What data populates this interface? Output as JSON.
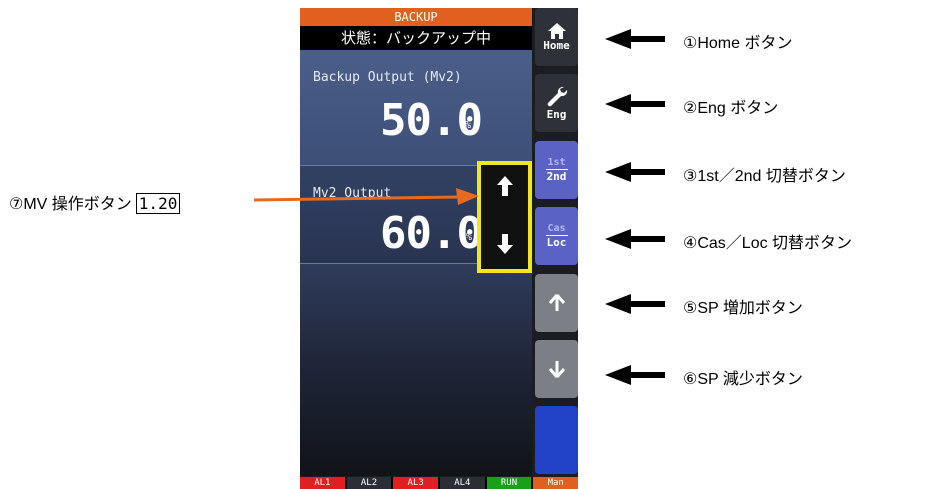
{
  "device": {
    "mode": "BACKUP",
    "state": "状態：バックアップ中",
    "pv1": {
      "label": "Backup Output (Mv2)",
      "value": "50.0",
      "unit": "%"
    },
    "pv2": {
      "label": "Mv2 Output",
      "value": "60.0",
      "unit": "%"
    },
    "side_buttons": {
      "home": "Home",
      "eng": "Eng",
      "first": "1st",
      "second": "2nd",
      "cas": "Cas",
      "loc": "Loc"
    },
    "alarms": [
      {
        "label": "AL1",
        "color": "#e02020"
      },
      {
        "label": "AL2",
        "color": "#2a2f36"
      },
      {
        "label": "AL3",
        "color": "#e02020"
      },
      {
        "label": "AL4",
        "color": "#2a2f36"
      },
      {
        "label": "RUN",
        "color": "#18a018"
      },
      {
        "label": "Man",
        "color": "#e2601f"
      }
    ]
  },
  "annotations": {
    "c1": "①Home ボタン",
    "c2": "②Eng ボタン",
    "c3": "③1st／2nd 切替ボタン",
    "c4": "④Cas／Loc 切替ボタン",
    "c5": "⑤SP 増加ボタン",
    "c6": "⑥SP 減少ボタン",
    "mv": "⑦MV 操作ボタン",
    "mv_ref": "1.20"
  },
  "colors": {
    "orange": "#e2601f",
    "yellow_frame": "#f2e620",
    "callout_arrow": "#e86a20"
  },
  "icons": [
    "home-icon",
    "wrench-icon",
    "arrow-up-icon",
    "arrow-down-icon",
    "black-left-arrow-icon"
  ]
}
